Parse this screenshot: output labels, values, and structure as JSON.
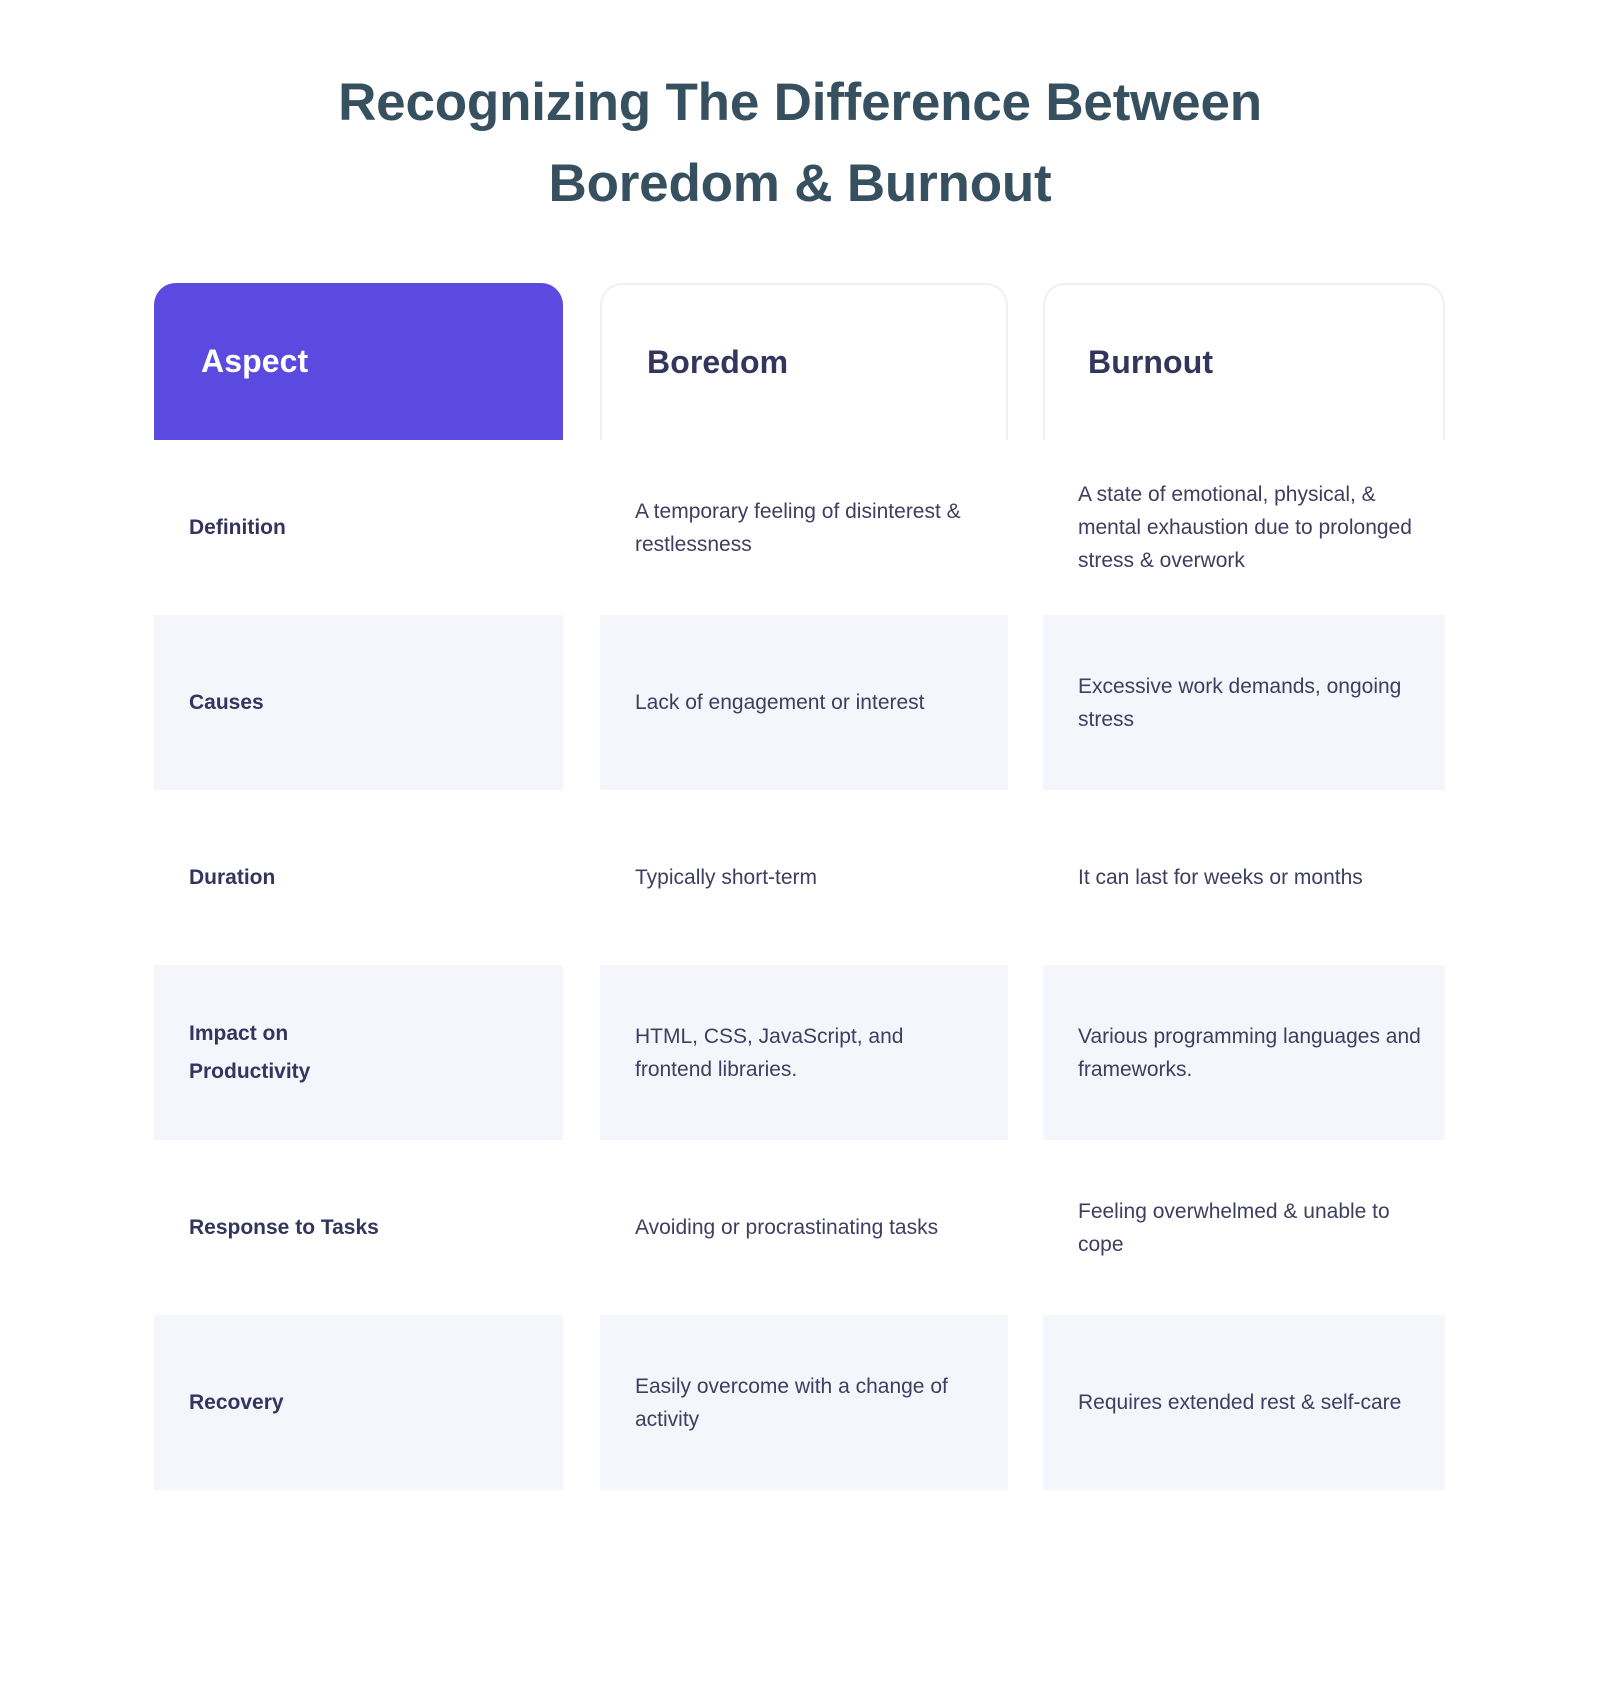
{
  "title": {
    "line1": "Recognizing The Difference Between",
    "line2": "Boredom & Burnout"
  },
  "colors": {
    "accent": "#5B4AE0",
    "title_text": "#36505F",
    "body_text": "#3D3E60",
    "header_text": "#34355C",
    "stripe": "#F5F5FC",
    "border": "#F0F0F3",
    "background": "#FFFFFF"
  },
  "table": {
    "headers": [
      {
        "label": "Aspect",
        "style": "accent"
      },
      {
        "label": "Boredom",
        "style": "plain"
      },
      {
        "label": "Burnout",
        "style": "plain"
      }
    ],
    "rows": [
      {
        "aspect": "Definition",
        "boredom": "A temporary feeling of disinterest & restlessness",
        "burnout": "A state of emotional, physical, & mental exhaustion due to prolonged stress & overwork",
        "striped": false
      },
      {
        "aspect": "Causes",
        "boredom": "Lack of engagement or interest",
        "burnout": "Excessive work demands, ongoing stress",
        "striped": true
      },
      {
        "aspect": "Duration",
        "boredom": "Typically short-term",
        "burnout": "It can last for weeks or months",
        "striped": false
      },
      {
        "aspect": " Impact on\nProductivity",
        "boredom": "HTML, CSS, JavaScript, and frontend libraries.",
        "burnout": "Various programming languages and frameworks.",
        "striped": true
      },
      {
        "aspect": "Response to Tasks",
        "boredom": "Avoiding or procrastinating tasks",
        "burnout": "Feeling overwhelmed & unable to cope",
        "striped": false
      },
      {
        "aspect": "Recovery",
        "boredom": "Easily overcome with a change of activity",
        "burnout": "Requires extended rest & self-care",
        "striped": true
      }
    ]
  }
}
